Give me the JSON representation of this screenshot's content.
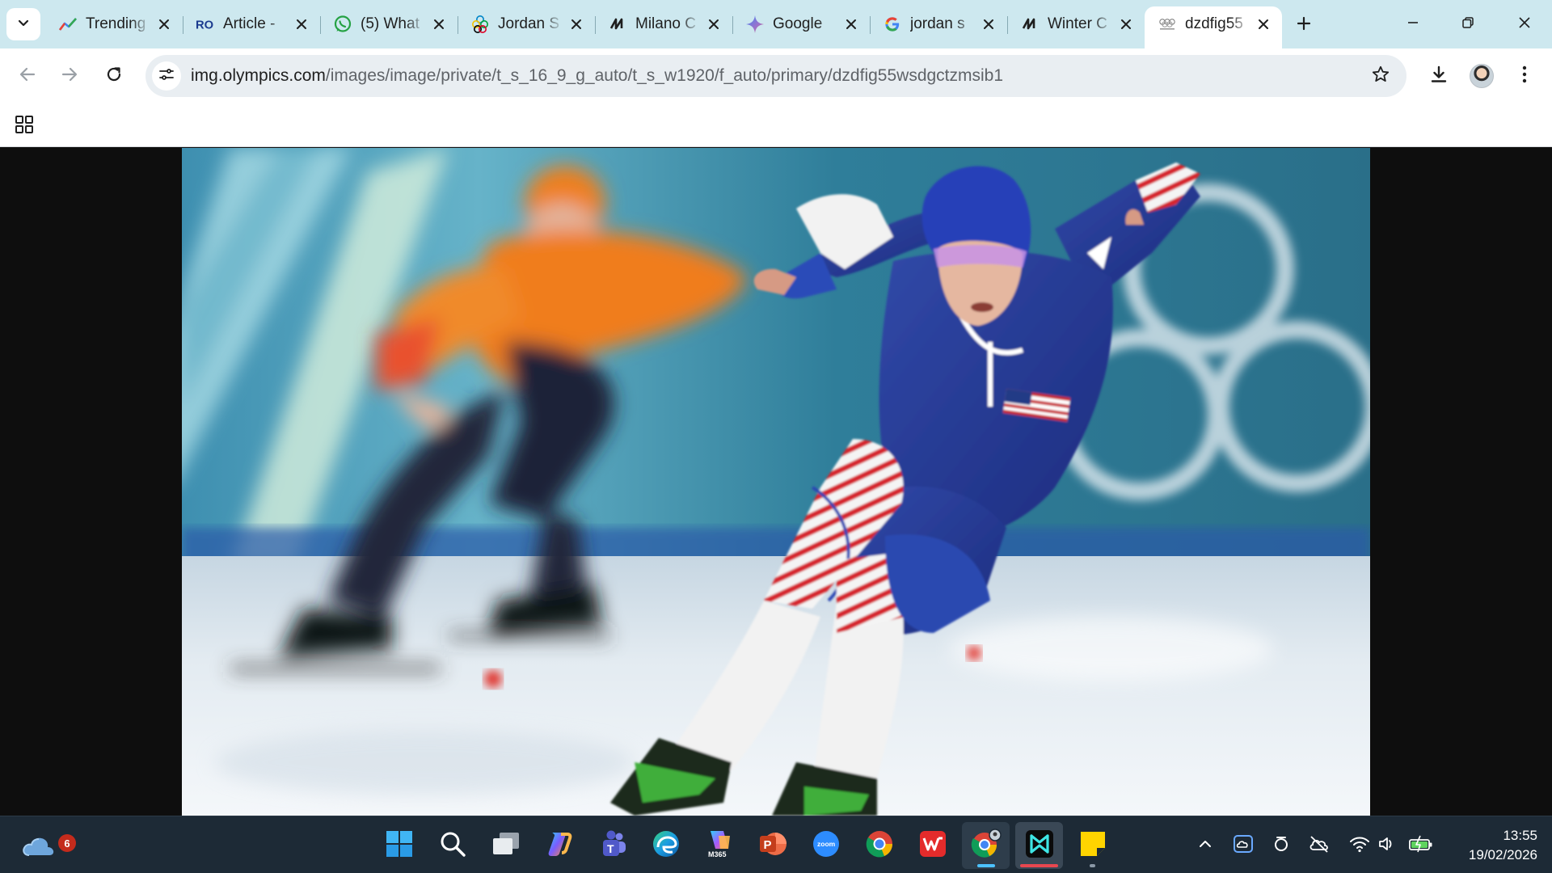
{
  "browser": {
    "tabs": [
      {
        "title": "Trending",
        "icon": "trending-icon",
        "active": false
      },
      {
        "title": "Article -",
        "icon": "ro-logo-icon",
        "active": false
      },
      {
        "title": "(5) What",
        "icon": "whatsapp-icon",
        "active": false
      },
      {
        "title": "Jordan S",
        "icon": "olympic-rings-icon",
        "active": false
      },
      {
        "title": "Milano C",
        "icon": "milano-cortina-icon",
        "active": false
      },
      {
        "title": "Google",
        "icon": "gemini-icon",
        "active": false
      },
      {
        "title": "jordan s",
        "icon": "google-icon",
        "active": false
      },
      {
        "title": "Winter C",
        "icon": "milano-cortina-icon",
        "active": false
      },
      {
        "title": "dzdfig55",
        "icon": "olympics-favicon-icon",
        "active": true
      }
    ],
    "address": {
      "host": "img.olympics.com",
      "path": "/images/image/private/t_s_16_9_g_auto/t_s_w1920/f_auto/primary/dzdfig55wsdgctzmsib1"
    }
  },
  "page": {
    "content": "image",
    "image_subject": "speed-skating-photo"
  },
  "taskbar": {
    "weather_badge": "6",
    "apps": [
      {
        "name": "windows-start-icon",
        "state": "normal"
      },
      {
        "name": "search-icon",
        "state": "normal"
      },
      {
        "name": "task-view-icon",
        "state": "normal"
      },
      {
        "name": "copilot-icon",
        "state": "normal"
      },
      {
        "name": "teams-icon",
        "state": "normal"
      },
      {
        "name": "edge-icon",
        "state": "normal"
      },
      {
        "name": "m365-icon",
        "state": "normal"
      },
      {
        "name": "powerpoint-icon",
        "state": "normal"
      },
      {
        "name": "zoom-icon",
        "state": "normal"
      },
      {
        "name": "chrome-icon",
        "state": "normal"
      },
      {
        "name": "wps-office-icon",
        "state": "normal"
      },
      {
        "name": "chrome-profile-icon",
        "state": "active"
      },
      {
        "name": "capcut-icon",
        "state": "highlight"
      },
      {
        "name": "sticky-notes-icon",
        "state": "open"
      }
    ],
    "clock": {
      "time": "13:55",
      "date": "19/02/2026"
    }
  },
  "colors": {
    "tabstrip": "#cde8ef",
    "omnibox": "#e9eef2",
    "taskbar": "#1d2a36",
    "accent": "#4cc2ff"
  }
}
